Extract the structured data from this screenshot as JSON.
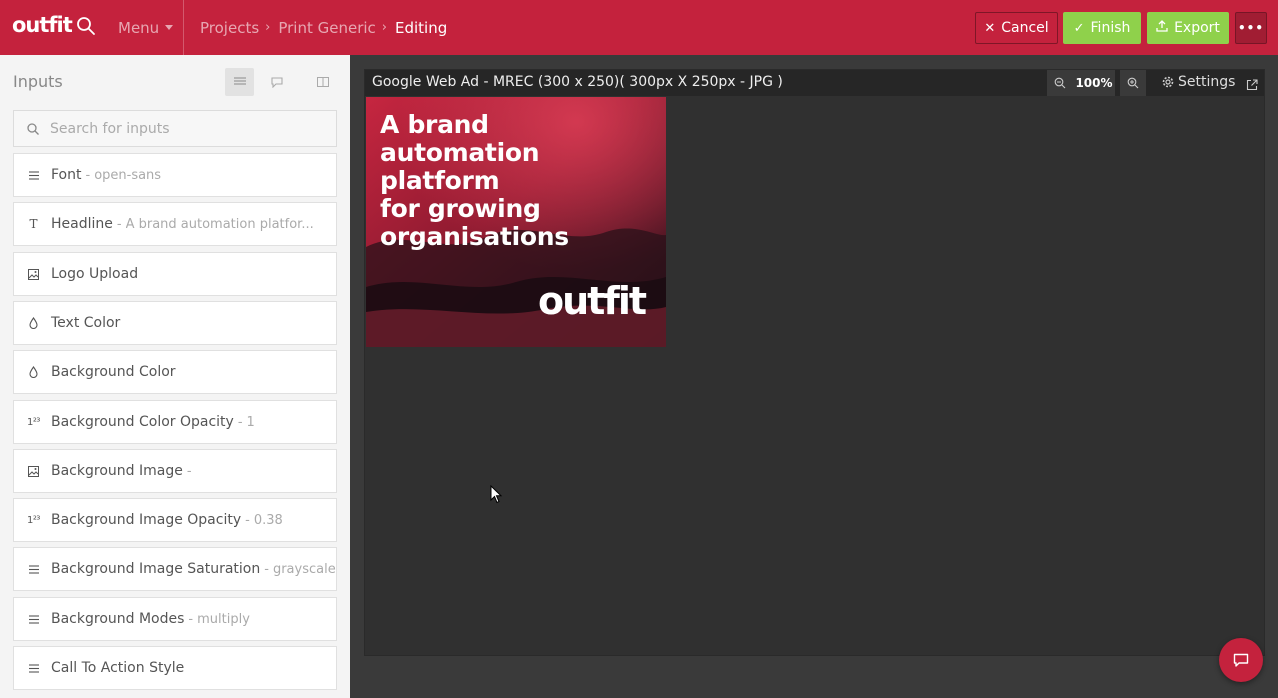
{
  "app": {
    "brand": "outfit"
  },
  "header": {
    "menu_label": "Menu",
    "breadcrumb": [
      "Projects",
      "Print Generic",
      "Editing"
    ],
    "buttons": {
      "cancel": "Cancel",
      "finish": "Finish",
      "export": "Export"
    }
  },
  "panel": {
    "title": "Inputs",
    "search": {
      "placeholder": "Search for inputs",
      "value": ""
    },
    "items": [
      {
        "icon": "list-icon",
        "label": "Font",
        "value": "open-sans"
      },
      {
        "icon": "text-icon",
        "label": "Headline",
        "value": "A brand automation platfor..."
      },
      {
        "icon": "image-icon",
        "label": "Logo Upload",
        "value": ""
      },
      {
        "icon": "droplet-icon",
        "label": "Text Color",
        "value": ""
      },
      {
        "icon": "droplet-icon",
        "label": "Background Color",
        "value": ""
      },
      {
        "icon": "number-icon",
        "label": "Background Color Opacity",
        "value": "1"
      },
      {
        "icon": "image-icon",
        "label": "Background Image",
        "value": "",
        "show_dash": true
      },
      {
        "icon": "number-icon",
        "label": "Background Image Opacity",
        "value": "0.38"
      },
      {
        "icon": "list-icon",
        "label": "Background Image Saturation",
        "value": "grayscale"
      },
      {
        "icon": "list-icon",
        "label": "Background Modes",
        "value": "multiply"
      },
      {
        "icon": "list-icon",
        "label": "Call To Action Style",
        "value": ""
      }
    ]
  },
  "canvas": {
    "title": "Google Web Ad - MREC (300 x 250)( 300px X 250px - JPG )",
    "zoom": "100%",
    "settings_label": "Settings",
    "ad": {
      "headline_lines": [
        "A brand",
        "automation",
        "platform",
        "for growing",
        "organisations"
      ],
      "logo": "outfit"
    }
  },
  "colors": {
    "brand": "#c4223d",
    "success": "#8fd14b",
    "canvas_bg": "#303030",
    "panel_bg": "#f4f4f4"
  }
}
